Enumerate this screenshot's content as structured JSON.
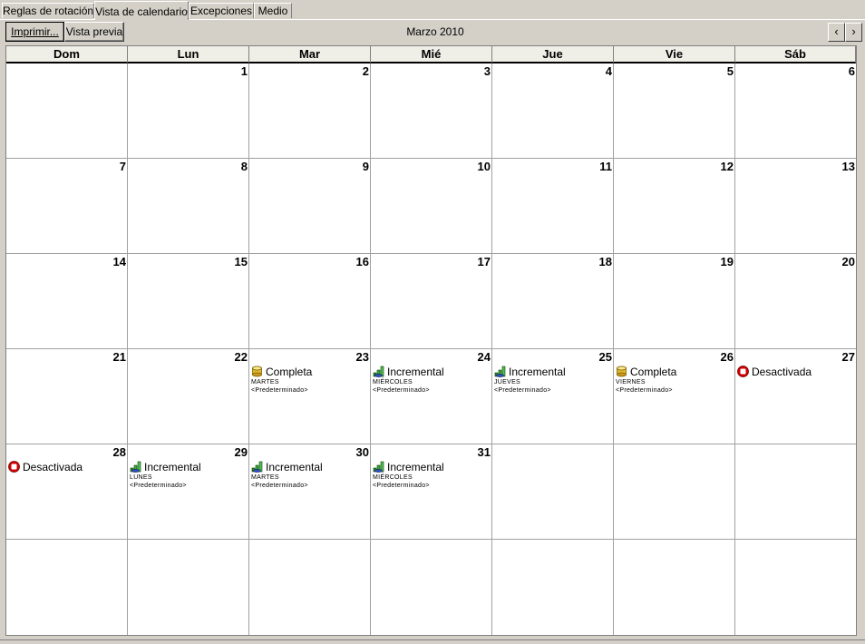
{
  "tabs": [
    {
      "label": "Reglas de rotación",
      "active": false
    },
    {
      "label": "Vista de calendario",
      "active": true
    },
    {
      "label": "Excepciones",
      "active": false
    },
    {
      "label": "Medio",
      "active": false
    }
  ],
  "toolbar": {
    "print_label": "Imprimir...",
    "preview_label": "Vista previa",
    "month_title": "Marzo 2010",
    "prev_glyph": "‹",
    "next_glyph": "›"
  },
  "weekdays": [
    "Dom",
    "Lun",
    "Mar",
    "Mié",
    "Jue",
    "Vie",
    "Sáb"
  ],
  "weeks": [
    [
      {
        "day": ""
      },
      {
        "day": "1"
      },
      {
        "day": "2"
      },
      {
        "day": "3"
      },
      {
        "day": "4"
      },
      {
        "day": "5"
      },
      {
        "day": "6"
      }
    ],
    [
      {
        "day": "7"
      },
      {
        "day": "8"
      },
      {
        "day": "9"
      },
      {
        "day": "10"
      },
      {
        "day": "11"
      },
      {
        "day": "12"
      },
      {
        "day": "13"
      }
    ],
    [
      {
        "day": "14"
      },
      {
        "day": "15"
      },
      {
        "day": "16"
      },
      {
        "day": "17"
      },
      {
        "day": "18"
      },
      {
        "day": "19"
      },
      {
        "day": "20"
      }
    ],
    [
      {
        "day": "21"
      },
      {
        "day": "22"
      },
      {
        "day": "23",
        "event": {
          "icon": "full-backup-icon",
          "label": "Completa",
          "day_name": "MARTES",
          "note": "<Predeterminado>"
        }
      },
      {
        "day": "24",
        "event": {
          "icon": "incremental-backup-icon",
          "label": "Incremental",
          "day_name": "MIÉRCOLES",
          "note": "<Predeterminado>"
        }
      },
      {
        "day": "25",
        "event": {
          "icon": "incremental-backup-icon",
          "label": "Incremental",
          "day_name": "JUEVES",
          "note": "<Predeterminado>"
        }
      },
      {
        "day": "26",
        "event": {
          "icon": "full-backup-icon",
          "label": "Completa",
          "day_name": "VIERNES",
          "note": "<Predeterminado>"
        }
      },
      {
        "day": "27",
        "event": {
          "icon": "disabled-icon",
          "label": "Desactivada"
        }
      }
    ],
    [
      {
        "day": "28",
        "event": {
          "icon": "disabled-icon",
          "label": "Desactivada"
        }
      },
      {
        "day": "29",
        "event": {
          "icon": "incremental-backup-icon",
          "label": "Incremental",
          "day_name": "LUNES",
          "note": "<Predeterminado>"
        }
      },
      {
        "day": "30",
        "event": {
          "icon": "incremental-backup-icon",
          "label": "Incremental",
          "day_name": "MARTES",
          "note": "<Predeterminado>"
        }
      },
      {
        "day": "31",
        "event": {
          "icon": "incremental-backup-icon",
          "label": "Incremental",
          "day_name": "MIÉRCOLES",
          "note": "<Predeterminado>"
        }
      },
      {
        "day": ""
      },
      {
        "day": ""
      },
      {
        "day": ""
      }
    ],
    [
      {
        "day": ""
      },
      {
        "day": ""
      },
      {
        "day": ""
      },
      {
        "day": ""
      },
      {
        "day": ""
      },
      {
        "day": ""
      },
      {
        "day": ""
      }
    ]
  ],
  "colors": {
    "window_bg": "#d4d0c8",
    "calendar_bg": "#ffffff",
    "header_bg": "#efefe7",
    "disabled_red": "#d00000"
  }
}
